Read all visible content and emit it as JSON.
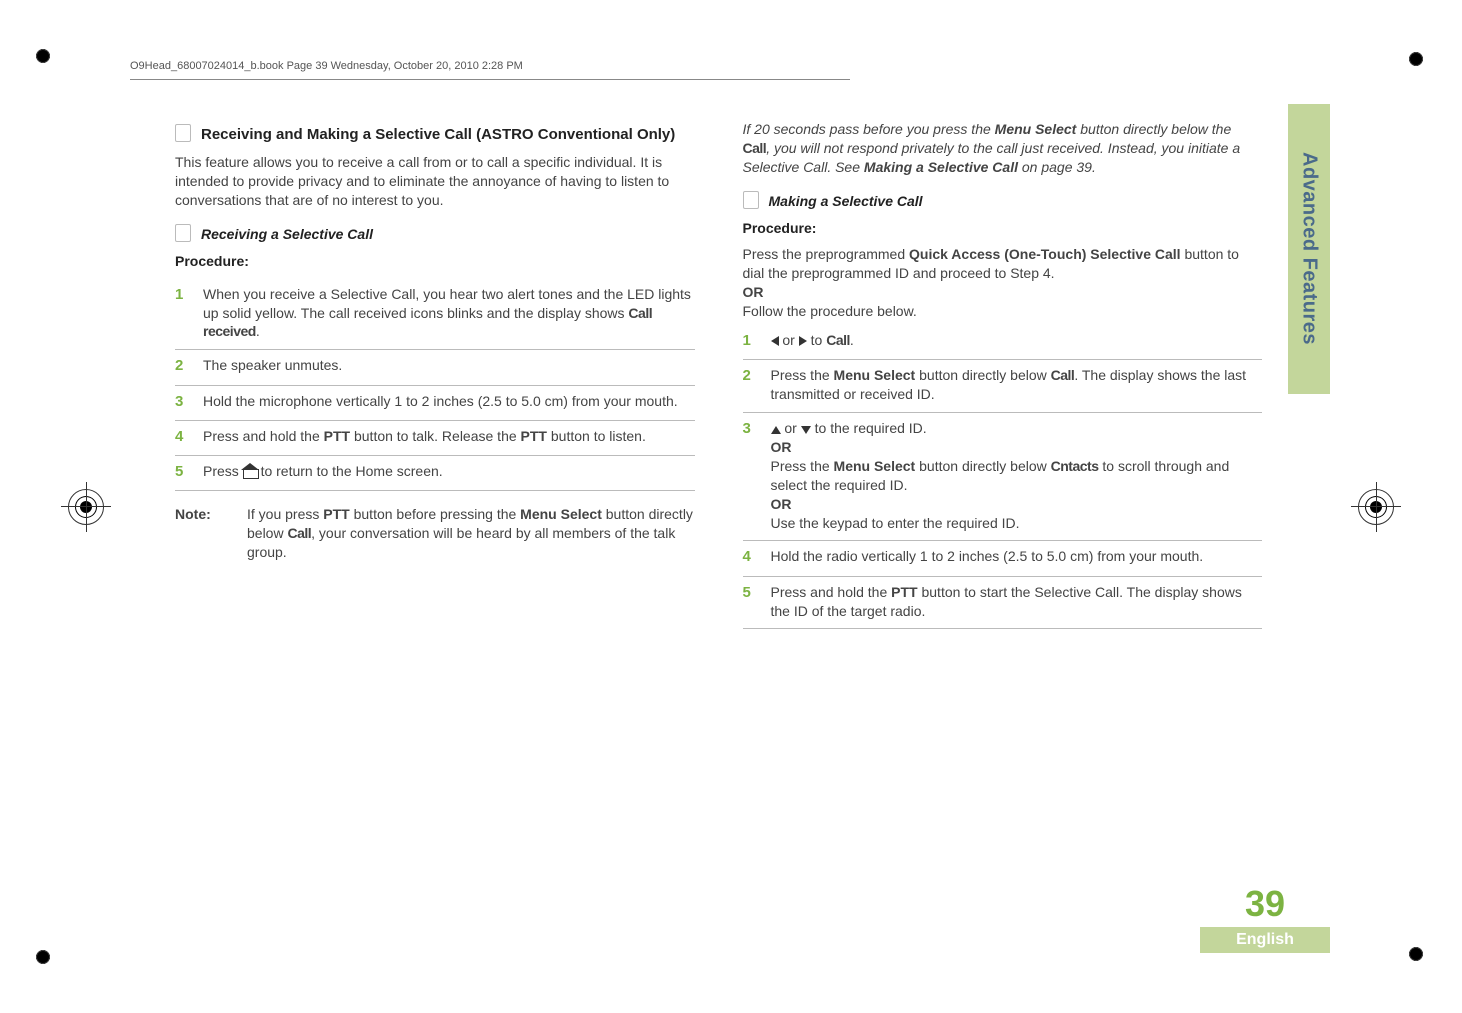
{
  "running_header": "O9Head_68007024014_b.book  Page 39  Wednesday, October 20, 2010  2:28 PM",
  "side_tab": "Advanced Features",
  "page_number": "39",
  "language": "English",
  "left": {
    "section_title": "Receiving and Making a Selective Call (ASTRO Conventional Only)",
    "intro": "This feature allows you to receive a call from or to call a specific individual. It is intended to provide privacy and to eliminate the annoyance of having to listen to conversations that are of no interest to you.",
    "sub_title": "Receiving a Selective Call",
    "proc_label": "Procedure:",
    "steps": [
      "When you receive a Selective Call, you hear two alert tones and the LED lights up solid yellow. The call received icons blinks and the display shows ",
      "The speaker unmutes.",
      "Hold the microphone vertically 1 to 2 inches (2.5 to 5.0 cm) from your mouth.",
      "Press and hold the PTT button to talk. Release the PTT button to listen.",
      "Press  to return to the Home screen."
    ],
    "step1_mono": "Call received",
    "note_label": "Note:",
    "note_body_a": "If you press ",
    "note_ptt": "PTT",
    "note_body_b": " button before pressing the ",
    "note_ms": "Menu Select",
    "note_body_c": " button directly below ",
    "note_call": "Call",
    "note_body_d": ", your conversation will be heard by all members of the talk group."
  },
  "right": {
    "intro_a": "If 20 seconds pass before you press the ",
    "intro_ms": "Menu Select",
    "intro_b": " button directly below the ",
    "intro_call": "Call",
    "intro_c": ", you will not respond privately to the call just received. Instead, you initiate a Selective Call. See ",
    "intro_ref": "Making a Selective Call",
    "intro_d": " on page 39.",
    "sub_title": "Making a Selective Call",
    "proc_label": "Procedure:",
    "pre_a": "Press the preprogrammed ",
    "pre_qa": "Quick Access (One-Touch) Selective Call",
    "pre_b": " button to dial the preprogrammed ID and proceed to Step 4.",
    "or": "OR",
    "pre_c": "Follow the procedure below.",
    "step1_or": " or ",
    "step1_to": " to ",
    "step1_call": "Call",
    "step2_a": "Press the ",
    "step2_ms": "Menu Select",
    "step2_b": " button directly below ",
    "step2_call": "Call",
    "step2_c": ". The display shows the last transmitted or received ID.",
    "step3_a": " or ",
    "step3_b": " to the required ID.",
    "step3_c": "Press the ",
    "step3_ms": "Menu Select",
    "step3_d": " button directly below ",
    "step3_cntacts": "Cntacts",
    "step3_e": " to scroll through and select the required ID.",
    "step3_f": "Use the keypad to enter the required ID.",
    "step4": "Hold the radio vertically 1 to 2 inches (2.5 to 5.0 cm) from your mouth.",
    "step5_a": "Press and hold the ",
    "step5_ptt": "PTT",
    "step5_b": " button to start the Selective Call. The display shows the ID of the target radio."
  }
}
